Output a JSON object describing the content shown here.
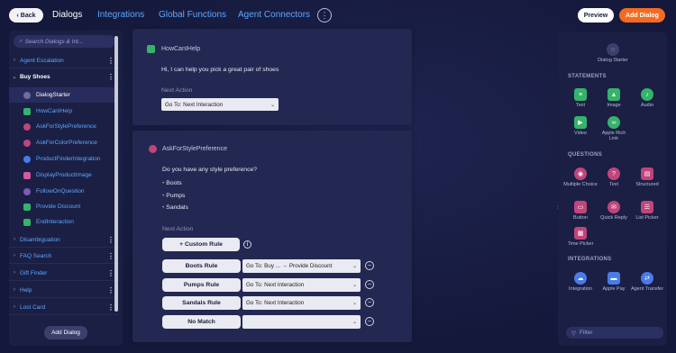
{
  "header": {
    "back_label": "Back",
    "tabs": [
      "Dialogs",
      "Integrations",
      "Global Functions",
      "Agent Connectors"
    ],
    "preview_label": "Preview",
    "add_dialog_label": "Add Dialog"
  },
  "sidebar": {
    "search_placeholder": "Search Dialogs & Int...",
    "groups_top": [
      {
        "label": "Agent Escalation"
      },
      {
        "label": "Buy Shoes"
      }
    ],
    "buy_shoes_items": [
      {
        "label": "DialogStarter",
        "icon": "dialog-starter-icon",
        "color": "#6a6fa0"
      },
      {
        "label": "HowCanIHelp",
        "icon": "text-icon",
        "color": "#35b36b"
      },
      {
        "label": "AskForStylePreference",
        "icon": "choice-icon",
        "color": "#c0457b"
      },
      {
        "label": "AskForColorPreference",
        "icon": "choice-icon",
        "color": "#c0457b"
      },
      {
        "label": "ProductFinderIntegration",
        "icon": "integration-icon",
        "color": "#4a7be8"
      },
      {
        "label": "DisplayProductImage",
        "icon": "image-icon",
        "color": "#d25aa0"
      },
      {
        "label": "FollowOnQuestion",
        "icon": "question-icon",
        "color": "#7a5cb0"
      },
      {
        "label": "Provide Discount",
        "icon": "text-icon",
        "color": "#35b36b"
      },
      {
        "label": "EndInteraction",
        "icon": "text-icon",
        "color": "#35b36b"
      }
    ],
    "groups_bottom": [
      {
        "label": "Disambiguation"
      },
      {
        "label": "FAQ Search"
      },
      {
        "label": "Gift Finder"
      },
      {
        "label": "Help"
      },
      {
        "label": "Lost Card"
      }
    ],
    "add_dialog_label": "Add Dialog"
  },
  "canvas": {
    "node1": {
      "title": "HowCanIHelp",
      "message": "Hi, I can help you pick a great pair of shoes",
      "next_action_label": "Next Action",
      "next_action_value": "Go To: Next Interaction"
    },
    "node2": {
      "title": "AskForStylePreference",
      "question": "Do you have any style preference?",
      "options": [
        "Boots",
        "Pumps",
        "Sandals"
      ],
      "next_action_label": "Next Action",
      "custom_rule_label": "+ Custom Rule",
      "rules": [
        {
          "name": "Boots Rule",
          "action": "Go To: Buy ...   → Provide Discount"
        },
        {
          "name": "Pumps Rule",
          "action": "Go To: Next Interaction"
        },
        {
          "name": "Sandals Rule",
          "action": "Go To: Next Interaction"
        },
        {
          "name": "No Match",
          "action": ""
        }
      ]
    }
  },
  "palette": {
    "dialog_starter_label": "Dialog Starter",
    "sections": {
      "statements": "STATEMENTS",
      "questions": "QUESTIONS",
      "integrations": "INTEGRATIONS"
    },
    "statements": [
      {
        "label": "Text",
        "color": "#35b36b",
        "icon": "text-icon"
      },
      {
        "label": "Image",
        "color": "#35b36b",
        "icon": "image-icon"
      },
      {
        "label": "Audio",
        "color": "#35b36b",
        "icon": "audio-icon"
      },
      {
        "label": "Video",
        "color": "#35b36b",
        "icon": "video-icon"
      },
      {
        "label": "Apple Rich Link",
        "color": "#35b36b",
        "icon": "link-icon"
      }
    ],
    "questions": [
      {
        "label": "Multiple Choice",
        "color": "#c0457b",
        "icon": "multiple-choice-icon"
      },
      {
        "label": "Text",
        "color": "#c0457b",
        "icon": "question-icon"
      },
      {
        "label": "Structured",
        "color": "#c0457b",
        "icon": "structured-icon"
      },
      {
        "label": "Button",
        "color": "#c0457b",
        "icon": "button-icon"
      },
      {
        "label": "Quick Reply",
        "color": "#c0457b",
        "icon": "quick-reply-icon"
      },
      {
        "label": "List Picker",
        "color": "#c0457b",
        "icon": "list-picker-icon"
      },
      {
        "label": "Time Picker",
        "color": "#c0457b",
        "icon": "time-picker-icon"
      }
    ],
    "integrations": [
      {
        "label": "Integration",
        "color": "#4a7be8",
        "icon": "cloud-icon"
      },
      {
        "label": "Apple Pay",
        "color": "#4a7be8",
        "icon": "apple-pay-icon"
      },
      {
        "label": "Agent Transfer",
        "color": "#4a7be8",
        "icon": "agent-transfer-icon"
      }
    ],
    "filter_placeholder": "Filter"
  }
}
